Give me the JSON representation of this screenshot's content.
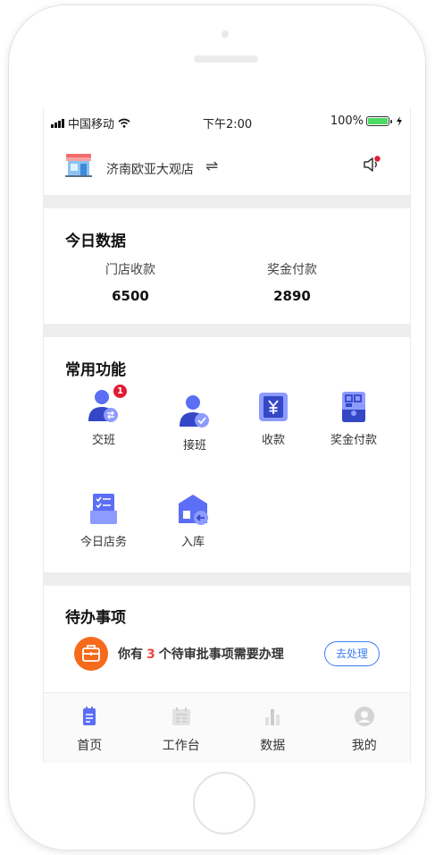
{
  "status_bar": {
    "carrier": "中国移动",
    "time": "下午2:00",
    "battery": "100%"
  },
  "store": {
    "name": "济南欧亚大观店",
    "switch_icon": "switch-arrows-icon",
    "sound_icon": "speaker-icon"
  },
  "today_data": {
    "title": "今日数据",
    "metrics": [
      {
        "label": "门店收款",
        "value": "6500"
      },
      {
        "label": "奖金付款",
        "value": "2890"
      }
    ]
  },
  "features": {
    "title": "常用功能",
    "items": [
      {
        "label": "交班",
        "icon": "handover-user-icon",
        "badge": "1"
      },
      {
        "label": "接班",
        "icon": "takeover-user-icon"
      },
      {
        "label": "收款",
        "icon": "yen-receipt-icon"
      },
      {
        "label": "奖金付款",
        "icon": "qr-wallet-icon"
      },
      {
        "label": "今日店务",
        "icon": "checklist-tray-icon"
      },
      {
        "label": "入库",
        "icon": "warehouse-inbound-icon"
      }
    ]
  },
  "todo": {
    "title": "待办事项",
    "text_prefix": "你有",
    "count": "3",
    "text_suffix": "个待审批事项需要办理",
    "button": "去处理",
    "icon": "briefcase-icon",
    "colors": {
      "icon_bg": "#f66a1c",
      "count": "#f04a3c",
      "button": "#3d7cf1"
    }
  },
  "tabbar": {
    "items": [
      {
        "label": "首页",
        "icon": "home-doc-icon",
        "active": true
      },
      {
        "label": "工作台",
        "icon": "calendar-icon",
        "active": false
      },
      {
        "label": "数据",
        "icon": "bar-chart-icon",
        "active": false
      },
      {
        "label": "我的",
        "icon": "profile-icon",
        "active": false
      }
    ]
  },
  "colors": {
    "accent": "#5b6ef5",
    "badge": "#e21a33",
    "divider": "#eeeeee"
  }
}
